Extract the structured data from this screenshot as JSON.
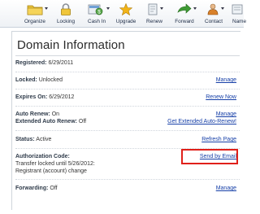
{
  "toolbar": {
    "items": [
      {
        "label": "Organize",
        "icon": "folder-icon"
      },
      {
        "label": "Locking",
        "icon": "lock-icon"
      },
      {
        "label": "Cash In",
        "icon": "cash-in-icon"
      },
      {
        "label": "Upgrade",
        "icon": "star-icon"
      },
      {
        "label": "Renew",
        "icon": "renew-icon"
      },
      {
        "label": "Forward",
        "icon": "forward-arrow-icon"
      },
      {
        "label": "Contact",
        "icon": "contact-person-icon"
      },
      {
        "label": "Name",
        "icon": "name-icon"
      }
    ]
  },
  "panel": {
    "title": "Domain Information",
    "registered": {
      "label": "Registered:",
      "value": "6/29/2011"
    },
    "locked": {
      "label": "Locked:",
      "value": "Unlocked",
      "action": "Manage"
    },
    "expires": {
      "label": "Expires On:",
      "value": "6/29/2012",
      "action": "Renew Now"
    },
    "auto_renew": {
      "label": "Auto Renew:",
      "value": "On",
      "action": "Manage"
    },
    "extended_auto_renew": {
      "label": "Extended Auto Renew:",
      "value": "Off",
      "action": "Get Extended Auto-Renew!"
    },
    "status": {
      "label": "Status:",
      "value": "Active",
      "action": "Refresh Page"
    },
    "auth_code": {
      "label": "Authorization Code:",
      "line1": "Transfer locked until 5/26/2012:",
      "line2": "Registrant (account) change",
      "action": "Send by Email"
    },
    "forwarding": {
      "label": "Forwarding:",
      "value": "Off",
      "action": "Manage"
    }
  },
  "colors": {
    "link": "#1740a8",
    "highlight": "#e0201a",
    "folder": "#e8c23a",
    "star": "#f2b417",
    "forward": "#3f9a34"
  }
}
